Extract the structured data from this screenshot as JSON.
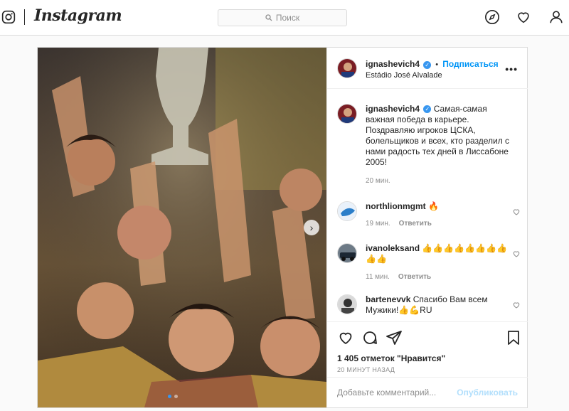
{
  "header": {
    "brand": "Instagram",
    "search_placeholder": "Поиск"
  },
  "post": {
    "author": "ignashevich4",
    "follow_label": "Подписаться",
    "location": "Estádio José Alvalade",
    "caption": "Самая-самая важная победа в карьере. Поздравляю игроков ЦСКА, болельщиков и всех, кто разделил с нами радость тех дней в Лиссабоне 2005!",
    "caption_time": "20 мин.",
    "comments": [
      {
        "user": "northlionmgmt",
        "text": "🔥",
        "time": "19 мин.",
        "reply": "Ответить"
      },
      {
        "user": "ivanoleksand",
        "text": "👍👍👍👍👍👍👍👍👍👍",
        "time": "11 мин.",
        "reply": "Ответить"
      },
      {
        "user": "bartenevvk",
        "text": "Спасибо Вам всем Мужики!👍💪RU"
      }
    ],
    "likes": "1 405 отметок \"Нравится\"",
    "posted_ago": "20 МИНУТ НАЗАД",
    "add_comment_placeholder": "Добавьте комментарий...",
    "publish_label": "Опубликовать"
  },
  "colors": {
    "accent": "#0095f6",
    "verified": "#3897f0"
  }
}
